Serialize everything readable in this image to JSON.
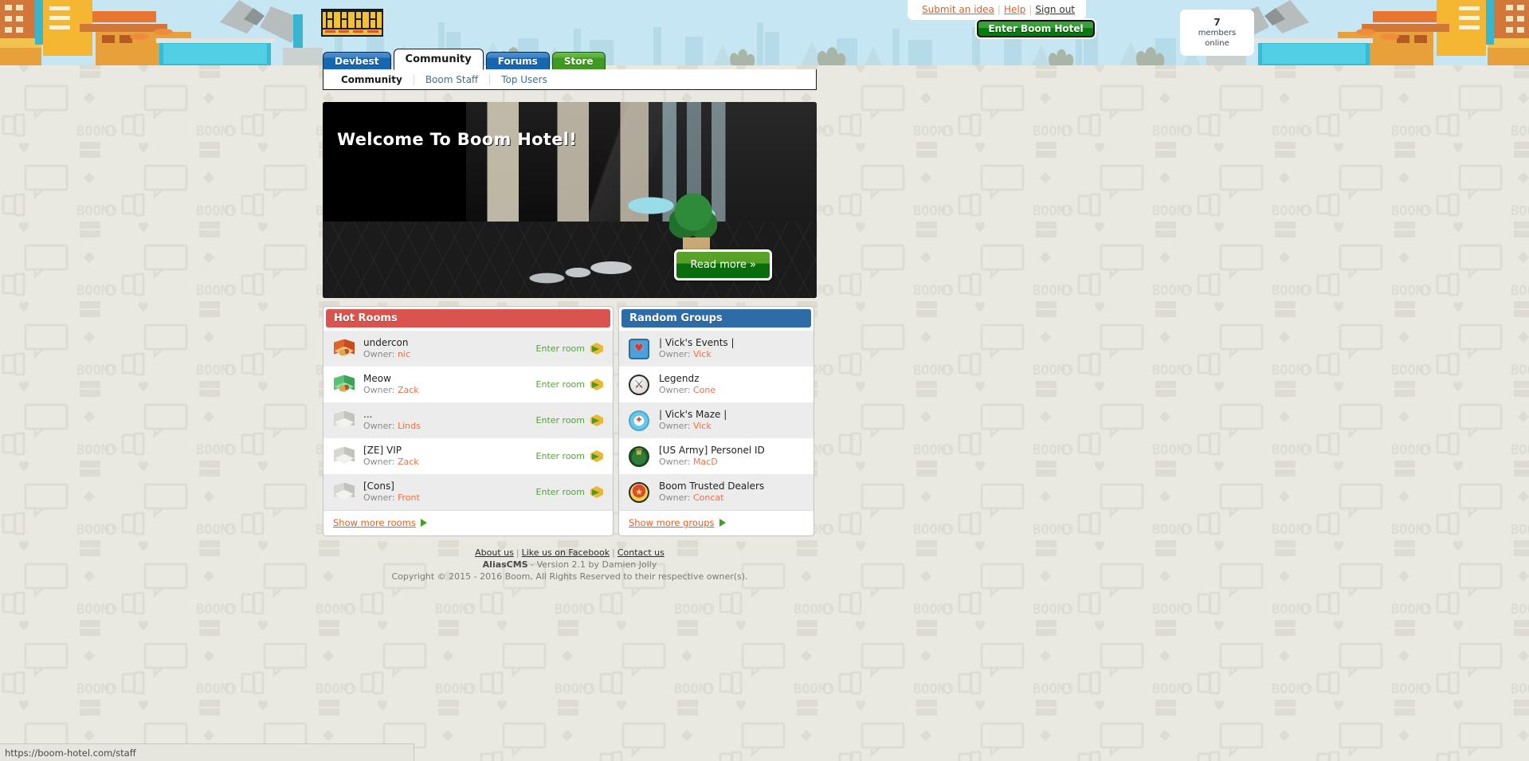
{
  "topbar": {
    "submit_idea": "Submit an idea",
    "help": "Help",
    "sign_out": "Sign out",
    "enter_hotel": "Enter Boom Hotel",
    "members_count": "7",
    "members_line1": "members",
    "members_line2": "online"
  },
  "logo": {
    "text": "BOOM"
  },
  "nav": {
    "tabs": [
      {
        "label": "Devbest",
        "style": "blue",
        "active": false
      },
      {
        "label": "Community",
        "style": "white",
        "active": true
      },
      {
        "label": "Forums",
        "style": "blue",
        "active": false
      },
      {
        "label": "Store",
        "style": "green",
        "active": false
      }
    ],
    "subnav": [
      {
        "label": "Community",
        "current": true
      },
      {
        "label": "Boom Staff",
        "current": false
      },
      {
        "label": "Top Users",
        "current": false
      }
    ]
  },
  "hero": {
    "title": "Welcome To Boom Hotel!",
    "read_more": "Read more »"
  },
  "hot_rooms": {
    "title": "Hot Rooms",
    "enter_label": "Enter room",
    "owner_label": "Owner:",
    "show_more": "Show more rooms",
    "rooms": [
      {
        "name": "undercon",
        "owner": "nic",
        "icon": "room-cube-orange"
      },
      {
        "name": "Meow",
        "owner": "Zack",
        "icon": "room-cube-green"
      },
      {
        "name": "...",
        "owner": "Linds",
        "icon": "room-cube-grey"
      },
      {
        "name": "[ZE] VIP",
        "owner": "Zack",
        "icon": "room-cube-grey"
      },
      {
        "name": "[Cons]",
        "owner": "Front",
        "icon": "room-cube-grey"
      }
    ]
  },
  "random_groups": {
    "title": "Random Groups",
    "owner_label": "Owner:",
    "show_more": "Show more groups",
    "groups": [
      {
        "name": "| Vick's Events |",
        "owner": "Vick",
        "icon": "group-badge-heart"
      },
      {
        "name": "Legendz",
        "owner": "Cone",
        "icon": "group-badge-sword"
      },
      {
        "name": "| Vick's Maze |",
        "owner": "Vick",
        "icon": "group-badge-compass"
      },
      {
        "name": "[US Army] Personel ID",
        "owner": "MacD",
        "icon": "group-badge-crest"
      },
      {
        "name": "Boom Trusted Dealers",
        "owner": "Concat",
        "icon": "group-badge-medal"
      }
    ]
  },
  "footer": {
    "about": "About us",
    "facebook": "Like us on Facebook",
    "contact": "Contact us",
    "cms_name": "AliasCMS",
    "cms_version": " - Version 2.1 by Damien Jolly",
    "copyright": "Copyright © 2015 - 2016 Boom, All Rights Reserved to their respective owner(s)."
  },
  "status_bar": {
    "url": "https://boom-hotel.com/staff"
  },
  "colors": {
    "hot_rooms_header": "#d9534f",
    "groups_header": "#2e6ca8",
    "link_orange": "#e06020",
    "enter_green": "#55a23b",
    "tab_blue": "#1766b0",
    "tab_green": "#3e9a20",
    "sky": "#c5e6f2",
    "page_bg": "#e8e7e0"
  }
}
